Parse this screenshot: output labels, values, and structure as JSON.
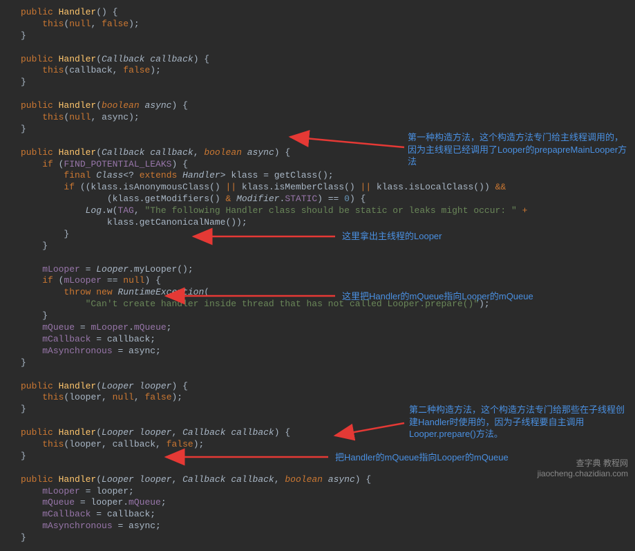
{
  "code": {
    "lines": [
      {
        "indent": 0,
        "tokens": [
          {
            "c": "kw-public",
            "t": "public"
          },
          {
            "t": " "
          },
          {
            "c": "method-def",
            "t": "Handler"
          },
          {
            "t": "() {"
          }
        ]
      },
      {
        "indent": 1,
        "tokens": [
          {
            "c": "kw-this",
            "t": "this"
          },
          {
            "t": "("
          },
          {
            "c": "kw-null",
            "t": "null"
          },
          {
            "t": ", "
          },
          {
            "c": "kw-false",
            "t": "false"
          },
          {
            "t": ");"
          }
        ]
      },
      {
        "indent": 0,
        "tokens": [
          {
            "t": "}"
          }
        ]
      },
      {
        "indent": 0,
        "tokens": [
          {
            "t": ""
          }
        ]
      },
      {
        "indent": 0,
        "tokens": [
          {
            "c": "kw-public",
            "t": "public"
          },
          {
            "t": " "
          },
          {
            "c": "method-def",
            "t": "Handler"
          },
          {
            "t": "("
          },
          {
            "c": "type",
            "t": "Callback"
          },
          {
            "t": " "
          },
          {
            "c": "param",
            "t": "callback"
          },
          {
            "t": ") {"
          }
        ]
      },
      {
        "indent": 1,
        "tokens": [
          {
            "c": "kw-this",
            "t": "this"
          },
          {
            "t": "(callback, "
          },
          {
            "c": "kw-false",
            "t": "false"
          },
          {
            "t": ");"
          }
        ]
      },
      {
        "indent": 0,
        "tokens": [
          {
            "t": "}"
          }
        ]
      },
      {
        "indent": 0,
        "tokens": [
          {
            "t": ""
          }
        ]
      },
      {
        "indent": 0,
        "tokens": [
          {
            "c": "kw-public",
            "t": "public"
          },
          {
            "t": " "
          },
          {
            "c": "method-def",
            "t": "Handler"
          },
          {
            "t": "("
          },
          {
            "c": "kw-boolean",
            "t": "boolean"
          },
          {
            "t": " "
          },
          {
            "c": "param",
            "t": "async"
          },
          {
            "t": ") {"
          }
        ]
      },
      {
        "indent": 1,
        "tokens": [
          {
            "c": "kw-this",
            "t": "this"
          },
          {
            "t": "("
          },
          {
            "c": "kw-null",
            "t": "null"
          },
          {
            "t": ", async);"
          }
        ]
      },
      {
        "indent": 0,
        "tokens": [
          {
            "t": "}"
          }
        ]
      },
      {
        "indent": 0,
        "tokens": [
          {
            "t": ""
          }
        ]
      },
      {
        "indent": 0,
        "tokens": [
          {
            "c": "kw-public",
            "t": "public"
          },
          {
            "t": " "
          },
          {
            "c": "method-def",
            "t": "Handler"
          },
          {
            "t": "("
          },
          {
            "c": "type",
            "t": "Callback"
          },
          {
            "t": " "
          },
          {
            "c": "param",
            "t": "callback"
          },
          {
            "t": ", "
          },
          {
            "c": "kw-boolean",
            "t": "boolean"
          },
          {
            "t": " "
          },
          {
            "c": "param",
            "t": "async"
          },
          {
            "t": ") {"
          }
        ]
      },
      {
        "indent": 1,
        "tokens": [
          {
            "c": "kw-if",
            "t": "if"
          },
          {
            "t": " ("
          },
          {
            "c": "constant",
            "t": "FIND_POTENTIAL_LEAKS"
          },
          {
            "t": ") {"
          }
        ]
      },
      {
        "indent": 2,
        "tokens": [
          {
            "c": "kw-final",
            "t": "final"
          },
          {
            "t": " "
          },
          {
            "c": "type",
            "t": "Class"
          },
          {
            "t": "<"
          },
          {
            "c": "punct",
            "t": "? "
          },
          {
            "c": "kw-extends",
            "t": "extends"
          },
          {
            "t": " "
          },
          {
            "c": "type",
            "t": "Handler"
          },
          {
            "t": "> klass = getClass();"
          }
        ]
      },
      {
        "indent": 2,
        "tokens": [
          {
            "c": "kw-if",
            "t": "if"
          },
          {
            "t": " ((klass.isAnonymousClass() "
          },
          {
            "c": "kw-public",
            "t": "||"
          },
          {
            "t": " klass.isMemberClass() "
          },
          {
            "c": "kw-public",
            "t": "||"
          },
          {
            "t": " klass.isLocalClass()) "
          },
          {
            "c": "kw-public",
            "t": "&&"
          }
        ]
      },
      {
        "indent": 4,
        "tokens": [
          {
            "t": "(klass.getModifiers() "
          },
          {
            "c": "kw-public",
            "t": "&"
          },
          {
            "t": " "
          },
          {
            "c": "type",
            "t": "Modifier"
          },
          {
            "t": "."
          },
          {
            "c": "constant",
            "t": "STATIC"
          },
          {
            "t": ") == "
          },
          {
            "c": "number",
            "t": "0"
          },
          {
            "t": ") {"
          }
        ]
      },
      {
        "indent": 3,
        "tokens": [
          {
            "c": "type",
            "t": "Log"
          },
          {
            "t": ".w("
          },
          {
            "c": "constant",
            "t": "TAG"
          },
          {
            "t": ", "
          },
          {
            "c": "string",
            "t": "\"The following Handler class should be static or leaks might occur: \""
          },
          {
            "t": " "
          },
          {
            "c": "kw-public",
            "t": "+"
          }
        ]
      },
      {
        "indent": 4,
        "tokens": [
          {
            "t": "klass.getCanonicalName());"
          }
        ]
      },
      {
        "indent": 2,
        "tokens": [
          {
            "t": "}"
          }
        ]
      },
      {
        "indent": 1,
        "tokens": [
          {
            "t": "}"
          }
        ]
      },
      {
        "indent": 0,
        "tokens": [
          {
            "t": ""
          }
        ]
      },
      {
        "indent": 1,
        "tokens": [
          {
            "c": "field",
            "t": "mLooper"
          },
          {
            "t": " = "
          },
          {
            "c": "type",
            "t": "Looper"
          },
          {
            "t": ".myLooper();"
          }
        ]
      },
      {
        "indent": 1,
        "tokens": [
          {
            "c": "kw-if",
            "t": "if"
          },
          {
            "t": " ("
          },
          {
            "c": "field",
            "t": "mLooper"
          },
          {
            "t": " == "
          },
          {
            "c": "kw-null",
            "t": "null"
          },
          {
            "t": ") {"
          }
        ]
      },
      {
        "indent": 2,
        "tokens": [
          {
            "c": "kw-throw",
            "t": "throw"
          },
          {
            "t": " "
          },
          {
            "c": "kw-new",
            "t": "new"
          },
          {
            "t": " "
          },
          {
            "c": "type",
            "t": "RuntimeException"
          },
          {
            "t": "("
          }
        ]
      },
      {
        "indent": 3,
        "tokens": [
          {
            "c": "string",
            "t": "\"Can't create handler inside thread that has not called Looper.prepare()\""
          },
          {
            "t": ");"
          }
        ]
      },
      {
        "indent": 1,
        "tokens": [
          {
            "t": "}"
          }
        ]
      },
      {
        "indent": 1,
        "tokens": [
          {
            "c": "field",
            "t": "mQueue"
          },
          {
            "t": " = "
          },
          {
            "c": "field",
            "t": "mLooper"
          },
          {
            "t": "."
          },
          {
            "c": "field",
            "t": "mQueue"
          },
          {
            "t": ";"
          }
        ]
      },
      {
        "indent": 1,
        "tokens": [
          {
            "c": "field",
            "t": "mCallback"
          },
          {
            "t": " = callback;"
          }
        ]
      },
      {
        "indent": 1,
        "tokens": [
          {
            "c": "field",
            "t": "mAsynchronous"
          },
          {
            "t": " = async;"
          }
        ]
      },
      {
        "indent": 0,
        "tokens": [
          {
            "t": "}"
          }
        ]
      },
      {
        "indent": 0,
        "tokens": [
          {
            "t": ""
          }
        ]
      },
      {
        "indent": 0,
        "tokens": [
          {
            "c": "kw-public",
            "t": "public"
          },
          {
            "t": " "
          },
          {
            "c": "method-def",
            "t": "Handler"
          },
          {
            "t": "("
          },
          {
            "c": "type",
            "t": "Looper"
          },
          {
            "t": " "
          },
          {
            "c": "param",
            "t": "looper"
          },
          {
            "t": ") {"
          }
        ]
      },
      {
        "indent": 1,
        "tokens": [
          {
            "c": "kw-this",
            "t": "this"
          },
          {
            "t": "(looper, "
          },
          {
            "c": "kw-null",
            "t": "null"
          },
          {
            "t": ", "
          },
          {
            "c": "kw-false",
            "t": "false"
          },
          {
            "t": ");"
          }
        ]
      },
      {
        "indent": 0,
        "tokens": [
          {
            "t": "}"
          }
        ]
      },
      {
        "indent": 0,
        "tokens": [
          {
            "t": ""
          }
        ]
      },
      {
        "indent": 0,
        "tokens": [
          {
            "c": "kw-public",
            "t": "public"
          },
          {
            "t": " "
          },
          {
            "c": "method-def",
            "t": "Handler"
          },
          {
            "t": "("
          },
          {
            "c": "type",
            "t": "Looper"
          },
          {
            "t": " "
          },
          {
            "c": "param",
            "t": "looper"
          },
          {
            "t": ", "
          },
          {
            "c": "type",
            "t": "Callback"
          },
          {
            "t": " "
          },
          {
            "c": "param",
            "t": "callback"
          },
          {
            "t": ") {"
          }
        ]
      },
      {
        "indent": 1,
        "tokens": [
          {
            "c": "kw-this",
            "t": "this"
          },
          {
            "t": "(looper, callback, "
          },
          {
            "c": "kw-false",
            "t": "false"
          },
          {
            "t": ");"
          }
        ]
      },
      {
        "indent": 0,
        "tokens": [
          {
            "t": "}"
          }
        ]
      },
      {
        "indent": 0,
        "tokens": [
          {
            "t": ""
          }
        ]
      },
      {
        "indent": 0,
        "tokens": [
          {
            "c": "kw-public",
            "t": "public"
          },
          {
            "t": " "
          },
          {
            "c": "method-def",
            "t": "Handler"
          },
          {
            "t": "("
          },
          {
            "c": "type",
            "t": "Looper"
          },
          {
            "t": " "
          },
          {
            "c": "param",
            "t": "looper"
          },
          {
            "t": ", "
          },
          {
            "c": "type",
            "t": "Callback"
          },
          {
            "t": " "
          },
          {
            "c": "param",
            "t": "callback"
          },
          {
            "t": ", "
          },
          {
            "c": "kw-boolean",
            "t": "boolean"
          },
          {
            "t": " "
          },
          {
            "c": "param",
            "t": "async"
          },
          {
            "t": ") {"
          }
        ]
      },
      {
        "indent": 1,
        "tokens": [
          {
            "c": "field",
            "t": "mLooper"
          },
          {
            "t": " = looper;"
          }
        ]
      },
      {
        "indent": 1,
        "tokens": [
          {
            "c": "field",
            "t": "mQueue"
          },
          {
            "t": " = looper."
          },
          {
            "c": "field",
            "t": "mQueue"
          },
          {
            "t": ";"
          }
        ]
      },
      {
        "indent": 1,
        "tokens": [
          {
            "c": "field",
            "t": "mCallback"
          },
          {
            "t": " = callback;"
          }
        ]
      },
      {
        "indent": 1,
        "tokens": [
          {
            "c": "field",
            "t": "mAsynchronous"
          },
          {
            "t": " = async;"
          }
        ]
      },
      {
        "indent": 0,
        "tokens": [
          {
            "t": "}"
          }
        ]
      }
    ]
  },
  "annotations": {
    "a1": "第一种构造方法，这个构造方法专门给主线程调用的，因为主线程已经调用了Looper的prepapreMainLooper方法",
    "a2": "这里拿出主线程的Looper",
    "a3": "这里把Handler的mQueue指向Looper的mQueue",
    "a4": "第二种构造方法，这个构造方法专门给那些在子线程创建Handler时使用的，因为子线程要自主调用Looper.prepare()方法。",
    "a5": "把Handler的mQueue指向Looper的mQueue"
  },
  "watermark": {
    "line1": "查字典 教程网",
    "line2": "jiaocheng.chazidian.com"
  },
  "arrow_color": "#e53935"
}
